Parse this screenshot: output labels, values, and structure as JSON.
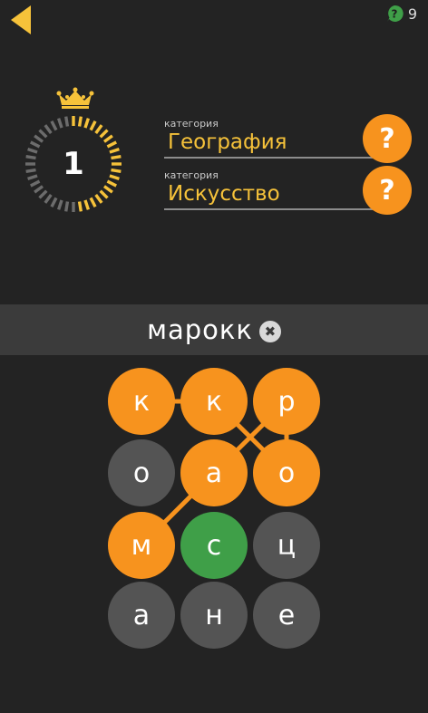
{
  "header": {
    "back_icon": "back-arrow-icon",
    "hint_icon": "question-icon",
    "hint_count": "9"
  },
  "level": {
    "number": "1",
    "crown_icon": "crown-icon"
  },
  "categories": [
    {
      "caption": "категория",
      "name": "География"
    },
    {
      "caption": "категория",
      "name": "Искусство"
    }
  ],
  "hint_button_label": "?",
  "word": {
    "current": "марокк",
    "clear_icon": "close-icon",
    "clear_label": "✖"
  },
  "board": {
    "tiles": [
      "к",
      "к",
      "р",
      "о",
      "а",
      "о",
      "м",
      "с",
      "ц",
      "а",
      "н",
      "е"
    ],
    "selected_path": [
      6,
      4,
      2,
      5,
      1,
      0
    ]
  },
  "colors": {
    "accent": "#f7931e",
    "category_text": "#f6c23a",
    "tile_idle": "#545454",
    "tile_green": "#3f9f48",
    "background": "#232323",
    "word_bar": "#3b3b3b"
  }
}
